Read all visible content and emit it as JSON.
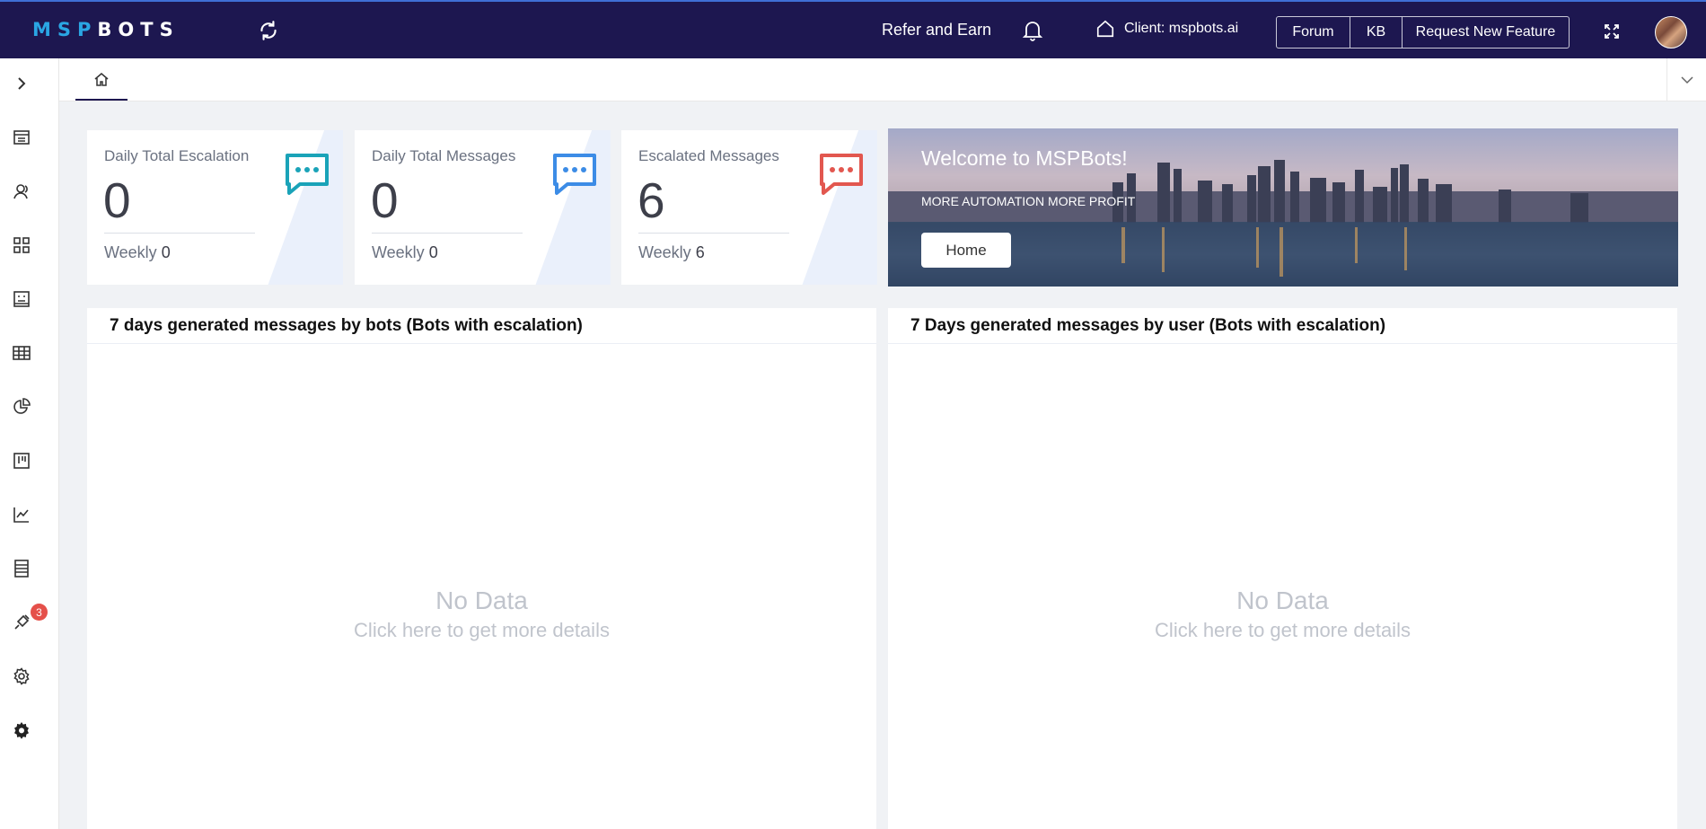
{
  "header": {
    "logo_prefix": "MSP",
    "logo_suffix": "BOTS",
    "refer_label": "Refer and Earn",
    "client_label": "Client: mspbots.ai",
    "forum_label": "Forum",
    "kb_label": "KB",
    "request_label": "Request New Feature"
  },
  "sidebar": {
    "notification_count": "3",
    "items": [
      "expand",
      "dashboard",
      "users",
      "widgets",
      "reports",
      "tables",
      "charts",
      "boards",
      "analytics",
      "logs",
      "integrations",
      "settings",
      "system-settings"
    ]
  },
  "tabs": [
    {
      "name": "home",
      "icon": "home-icon"
    }
  ],
  "cards": [
    {
      "title": "Daily Total Escalation",
      "value": "0",
      "weekly_label": "Weekly",
      "weekly_value": "0",
      "icon_color": "#1aa3b8"
    },
    {
      "title": "Daily Total Messages",
      "value": "0",
      "weekly_label": "Weekly",
      "weekly_value": "0",
      "icon_color": "#3c8ce6"
    },
    {
      "title": "Escalated Messages",
      "value": "6",
      "weekly_label": "Weekly",
      "weekly_value": "6",
      "icon_color": "#e2574f"
    }
  ],
  "banner": {
    "title": "Welcome to MSPBots!",
    "subtitle": "MORE AUTOMATION MORE PROFIT",
    "button_label": "Home"
  },
  "panels": [
    {
      "title": "7 days generated messages by bots (Bots with escalation)",
      "empty_title": "No Data",
      "empty_hint": "Click here to get more details"
    },
    {
      "title": "7 Days generated messages by user (Bots with escalation)",
      "empty_title": "No Data",
      "empty_hint": "Click here to get more details"
    }
  ]
}
